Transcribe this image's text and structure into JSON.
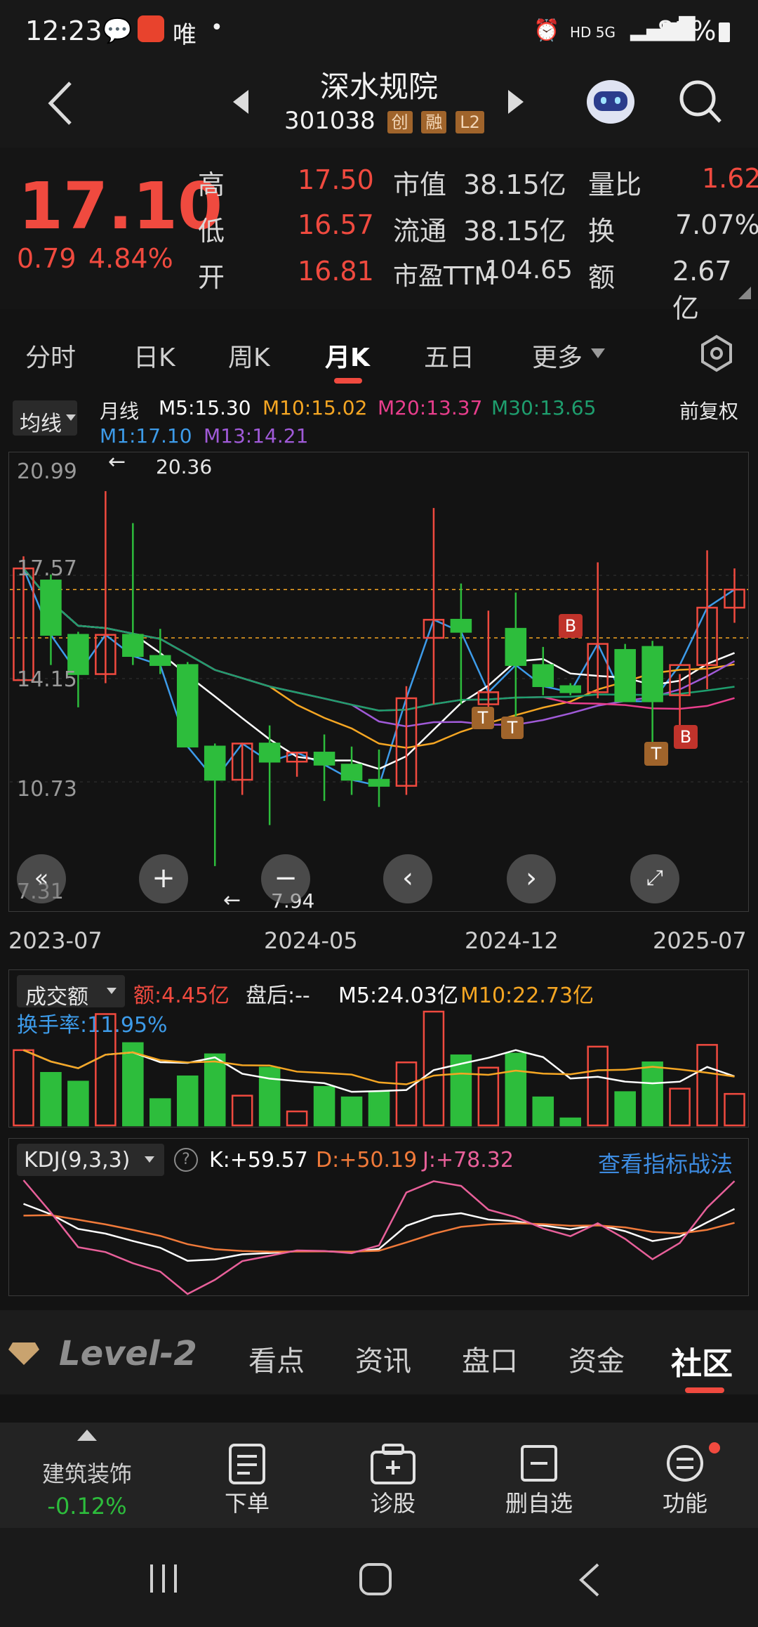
{
  "status_bar": {
    "time": "12:23",
    "carrier_text": "唯",
    "signal": "HD 5G",
    "battery": "81%"
  },
  "header": {
    "title": "深水规院",
    "code": "301038",
    "tags": [
      "创",
      "融",
      "L2"
    ]
  },
  "quote": {
    "price": "17.10",
    "change": "0.79",
    "change_pct": "4.84%",
    "high_label": "高",
    "high": "17.50",
    "low_label": "低",
    "low": "16.57",
    "open_label": "开",
    "open": "16.81",
    "mcap_label": "市值",
    "mcap": "38.15亿",
    "float_label": "流通",
    "float": "38.15亿",
    "pe_label": "市盈TTM",
    "pe": "104.65",
    "vr_label": "量比",
    "vr": "1.62",
    "turnover_label": "换",
    "turnover": "7.07%",
    "amount_label": "额",
    "amount": "2.67亿"
  },
  "tabs": [
    "分时",
    "日K",
    "周K",
    "月K",
    "五日",
    "更多"
  ],
  "active_tab": "月K",
  "ma_legend": {
    "selector": "均线",
    "period": "月线",
    "m5": "M5:15.30",
    "m10": "M10:15.02",
    "m20": "M20:13.37",
    "m30": "M30:13.65",
    "m1": "M1:17.10",
    "m13": "M13:14.21",
    "adjust": "前复权"
  },
  "price_axis": [
    "20.99",
    "17.57",
    "14.15",
    "10.73",
    "7.31"
  ],
  "annotations": {
    "max": "20.36",
    "min": "7.94"
  },
  "date_axis": [
    "2023-07",
    "2024-05",
    "2024-12",
    "2025-07"
  ],
  "volume_legend": {
    "selector": "成交额",
    "amount": "额:4.45亿",
    "after": "盘后:--",
    "m5": "M5:24.03亿",
    "m10": "M10:22.73亿",
    "turnover": "换手率:11.95%"
  },
  "kdj_legend": {
    "selector": "KDJ(9,3,3)",
    "k": "K:+59.57",
    "d": "D:+50.19",
    "j": "J:+78.32",
    "link": "查看指标战法"
  },
  "markers": {
    "b": "B",
    "t": "T"
  },
  "subtabs": [
    "Level-2",
    "看点",
    "资讯",
    "盘口",
    "资金",
    "社区"
  ],
  "toolbar": {
    "sector": "建筑装饰",
    "sector_change": "-0.12%",
    "order": "下单",
    "diagnose": "诊股",
    "remove": "删自选",
    "func": "功能"
  },
  "colors": {
    "up": "#f04a3f",
    "down": "#2dbd3c",
    "m5": "#ffffff",
    "m10": "#f5a623",
    "m20": "#e83e8c",
    "m30": "#1e9e6e",
    "m1": "#3d9be9",
    "m13": "#a05ad8",
    "k": "#ffffff",
    "d": "#f07a3a",
    "j": "#e8609a",
    "link": "#3d8be0"
  },
  "chart_data": {
    "type": "candlestick",
    "ylim": [
      7.31,
      20.99
    ],
    "candles": [
      {
        "o": 14.1,
        "h": 18.2,
        "l": 13.9,
        "c": 17.8
      },
      {
        "o": 17.4,
        "h": 17.6,
        "l": 14.6,
        "c": 15.6
      },
      {
        "o": 15.6,
        "h": 15.7,
        "l": 13.2,
        "c": 14.3
      },
      {
        "o": 14.3,
        "h": 20.36,
        "l": 14.0,
        "c": 15.6
      },
      {
        "o": 15.6,
        "h": 19.3,
        "l": 14.6,
        "c": 14.9
      },
      {
        "o": 14.9,
        "h": 15.8,
        "l": 14.3,
        "c": 14.6
      },
      {
        "o": 14.6,
        "h": 14.7,
        "l": 11.9,
        "c": 11.9
      },
      {
        "o": 11.9,
        "h": 12.0,
        "l": 7.94,
        "c": 10.8
      },
      {
        "o": 10.8,
        "h": 12.0,
        "l": 10.3,
        "c": 12.0
      },
      {
        "o": 12.0,
        "h": 12.6,
        "l": 9.3,
        "c": 11.4
      },
      {
        "o": 11.4,
        "h": 11.7,
        "l": 10.9,
        "c": 11.7
      },
      {
        "o": 11.7,
        "h": 12.3,
        "l": 10.1,
        "c": 11.3
      },
      {
        "o": 11.3,
        "h": 11.9,
        "l": 10.3,
        "c": 10.8
      },
      {
        "o": 10.8,
        "h": 11.8,
        "l": 9.9,
        "c": 10.6
      },
      {
        "o": 10.6,
        "h": 13.9,
        "l": 10.3,
        "c": 13.5
      },
      {
        "o": 15.5,
        "h": 19.8,
        "l": 13.3,
        "c": 16.1
      },
      {
        "o": 16.1,
        "h": 17.3,
        "l": 13.3,
        "c": 15.7
      },
      {
        "o": 13.3,
        "h": 16.4,
        "l": 13.1,
        "c": 13.7
      },
      {
        "o": 15.8,
        "h": 17.0,
        "l": 12.9,
        "c": 14.6
      },
      {
        "o": 14.6,
        "h": 15.2,
        "l": 13.6,
        "c": 13.9
      },
      {
        "o": 13.9,
        "h": 14.0,
        "l": 13.6,
        "c": 13.7
      },
      {
        "o": 13.7,
        "h": 18.0,
        "l": 13.5,
        "c": 15.3
      },
      {
        "o": 15.1,
        "h": 15.3,
        "l": 13.4,
        "c": 13.4
      },
      {
        "o": 15.2,
        "h": 15.4,
        "l": 11.8,
        "c": 13.4
      },
      {
        "o": 13.6,
        "h": 14.3,
        "l": 12.2,
        "c": 14.6
      },
      {
        "o": 14.6,
        "h": 18.4,
        "l": 13.8,
        "c": 16.5
      },
      {
        "o": 16.5,
        "h": 17.8,
        "l": 16.0,
        "c": 17.1
      }
    ]
  }
}
